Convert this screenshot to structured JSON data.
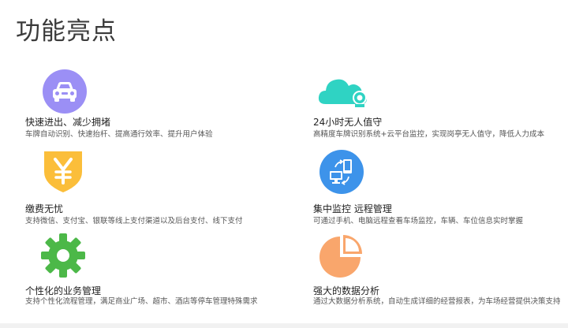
{
  "page": {
    "title": "功能亮点"
  },
  "features": [
    {
      "title": "快速进出、减少拥堵",
      "desc": "车牌自动识别、快速抬杆、提高通行效率、提升用户体验",
      "icon": "car-icon",
      "color": "#9b8ff5"
    },
    {
      "title": "24小时无人值守",
      "desc": "高精度车牌识别系统+云平台监控，实现岗亭无人值守，降低人力成本",
      "icon": "cloud-camera-icon",
      "color": "#2fd3c3"
    },
    {
      "title": "缴费无忧",
      "desc": "支持微信、支付宝、银联等线上支付渠道以及后台支付、线下支付",
      "icon": "yuan-shield-icon",
      "color": "#fbbe3a"
    },
    {
      "title": "集中监控 远程管理",
      "desc": "可通过手机、电脑远程查看车场监控，车辆、车位信息实时掌握",
      "icon": "remote-devices-icon",
      "color": "#3d93ea"
    },
    {
      "title": "个性化的业务管理",
      "desc": "支持个性化流程管理，满足商业广场、超市、酒店等停车管理特殊需求",
      "icon": "gear-icon",
      "color": "#4cb848"
    },
    {
      "title": "强大的数据分析",
      "desc": "通过大数据分析系统，自动生成详细的经营报表，为车场经营提供决策支持",
      "icon": "pie-chart-icon",
      "color": "#f9a66c"
    }
  ]
}
